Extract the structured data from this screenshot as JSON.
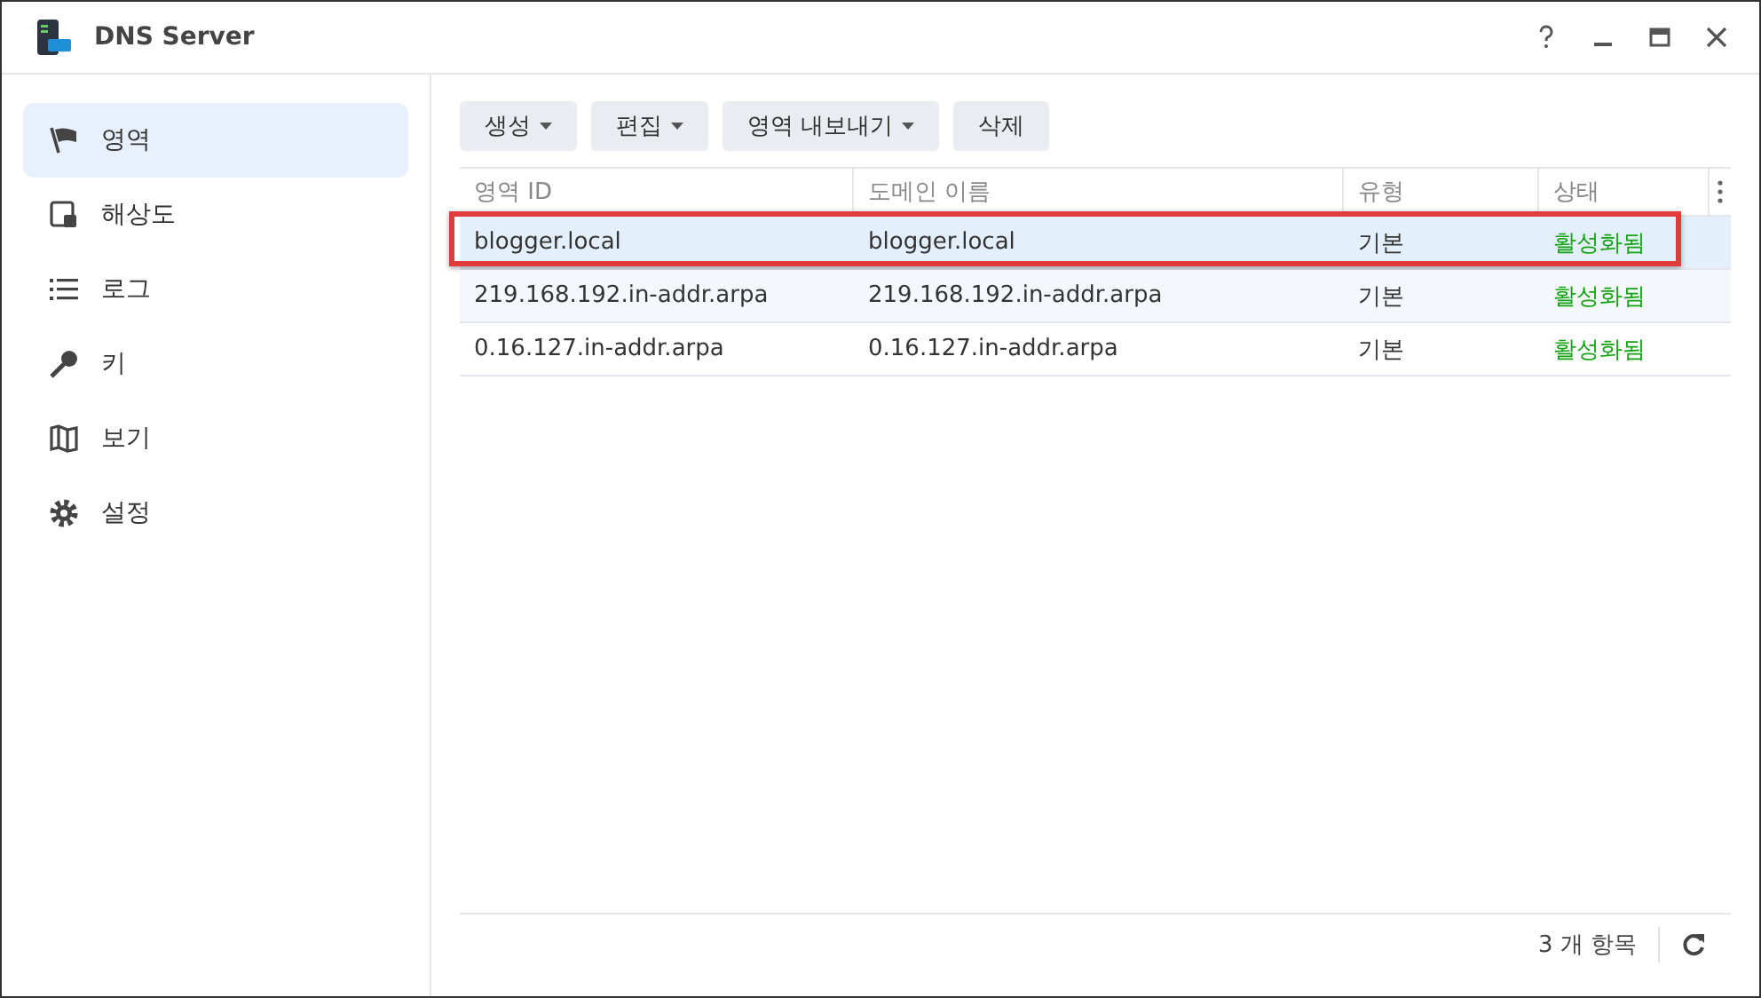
{
  "window": {
    "title": "DNS Server"
  },
  "sidebar": {
    "items": [
      {
        "label": "영역",
        "kind": "flag",
        "selected": true
      },
      {
        "label": "해상도",
        "kind": "resolve",
        "selected": false
      },
      {
        "label": "로그",
        "kind": "list",
        "selected": false
      },
      {
        "label": "키",
        "kind": "key",
        "selected": false
      },
      {
        "label": "보기",
        "kind": "map",
        "selected": false
      },
      {
        "label": "설정",
        "kind": "gear",
        "selected": false
      }
    ]
  },
  "toolbar": [
    {
      "label": "생성",
      "dropdown": true
    },
    {
      "label": "편집",
      "dropdown": true
    },
    {
      "label": "영역 내보내기",
      "dropdown": true
    },
    {
      "label": "삭제",
      "dropdown": false
    }
  ],
  "table": {
    "columns": [
      "영역 ID",
      "도메인 이름",
      "유형",
      "상태"
    ],
    "rows": [
      {
        "cells": [
          "blogger.local",
          "blogger.local",
          "기본",
          "활성화됨"
        ],
        "selected": true,
        "highlighted": true
      },
      {
        "cells": [
          "219.168.192.in-addr.arpa",
          "219.168.192.in-addr.arpa",
          "기본",
          "활성화됨"
        ],
        "selected": false,
        "highlighted": false
      },
      {
        "cells": [
          "0.16.127.in-addr.arpa",
          "0.16.127.in-addr.arpa",
          "기본",
          "활성화됨"
        ],
        "selected": false,
        "highlighted": false
      }
    ]
  },
  "status_bar": {
    "count": "3 개 항목"
  }
}
